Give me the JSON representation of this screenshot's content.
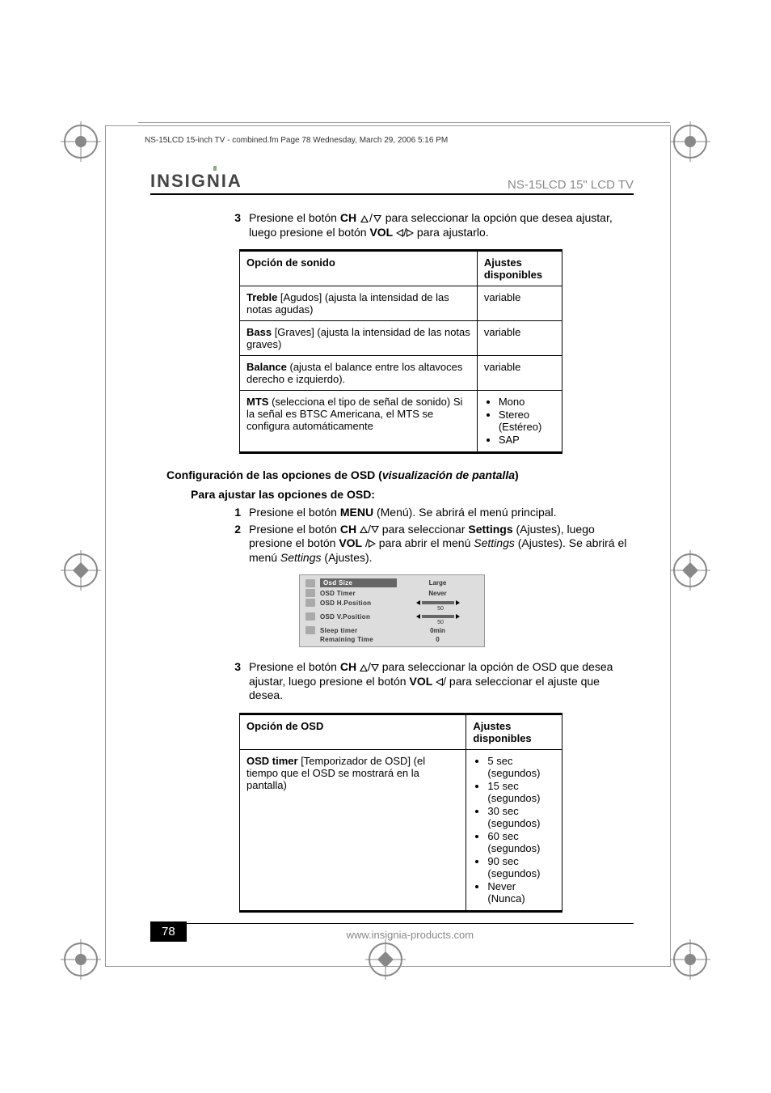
{
  "fm_line": "NS-15LCD 15-inch TV - combined.fm  Page 78  Wednesday, March 29, 2006  5:16 PM",
  "brand": "INSIGNIA",
  "doc_title": "NS-15LCD 15\" LCD TV",
  "step3a_pre": "Presione el botón ",
  "step3a_ch": "CH",
  "step3a_mid": " para seleccionar la opción que desea ajustar, luego presione el botón ",
  "step3a_vol": "VOL",
  "step3a_post": " para ajustarlo.",
  "table1": {
    "h1": "Opción de sonido",
    "h2": "Ajustes disponibles",
    "rows": [
      {
        "opt_bold": "Treble",
        "opt_rest": " [Agudos] (ajusta la intensidad de las notas agudas)",
        "val": "variable"
      },
      {
        "opt_bold": "Bass",
        "opt_rest": " [Graves] (ajusta la intensidad de las notas graves)",
        "val": "variable"
      },
      {
        "opt_bold": "Balance",
        "opt_rest": " (ajusta el balance entre los altavoces derecho e izquierdo).",
        "val": "variable"
      },
      {
        "opt_bold": "MTS",
        "opt_rest": " (selecciona el tipo de señal de sonido) Si la señal es BTSC Americana, el MTS se configura automáticamente",
        "list": [
          "Mono",
          "Stereo (Estéreo)",
          "SAP"
        ]
      }
    ]
  },
  "section_head_pre": "Configuración de las opciones de OSD (",
  "section_head_i": "visualización de pantalla",
  "section_head_post": ")",
  "sub_head": "Para ajustar las opciones de OSD:",
  "step1_pre": "Presione el botón ",
  "step1_b": "MENU",
  "step1_post": " (Menú). Se abrirá el menú principal.",
  "step2_pre": "Presione el botón ",
  "step2_ch": "CH",
  "step2_mid1": " para seleccionar ",
  "step2_settings": "Settings",
  "step2_mid2": " (Ajustes), luego presione el botón ",
  "step2_vol": "VOL",
  "step2_mid3": " para abrir el menú ",
  "step2_i1": "Settings",
  "step2_mid4": " (Ajustes). Se abrirá el menú ",
  "step2_i2": "Settings",
  "step2_post": " (Ajustes).",
  "osd": {
    "rows": [
      {
        "label": "Osd Size",
        "val": "Large",
        "sel": true
      },
      {
        "label": "OSD Timer",
        "val": "Never"
      },
      {
        "label": "OSD H.Position",
        "slider": true,
        "num": "50"
      },
      {
        "label": "OSD V.Position",
        "slider": true,
        "num": "50"
      },
      {
        "label": "Sleep timer",
        "val": "0min"
      },
      {
        "label": "Remaining Time",
        "val": "0",
        "noicon": true
      }
    ]
  },
  "step3b_pre": "Presione el botón ",
  "step3b_ch": "CH",
  "step3b_mid": " para seleccionar la opción de OSD que desea ajustar, luego presione el botón ",
  "step3b_vol": "VOL",
  "step3b_post": "/ para seleccionar el ajuste que desea.",
  "table2": {
    "h1": "Opción de OSD",
    "h2": "Ajustes disponibles",
    "rows": [
      {
        "opt_bold": "OSD timer",
        "opt_rest": " [Temporizador de OSD] (el tiempo que el OSD se mostrará en la pantalla)",
        "list": [
          "5 sec (segundos)",
          "15 sec (segundos)",
          "30 sec (segundos)",
          "60 sec (segundos)",
          "90 sec (segundos)",
          "Never (Nunca)"
        ]
      }
    ]
  },
  "page_num": "78",
  "footer_url": "www.insignia-products.com"
}
